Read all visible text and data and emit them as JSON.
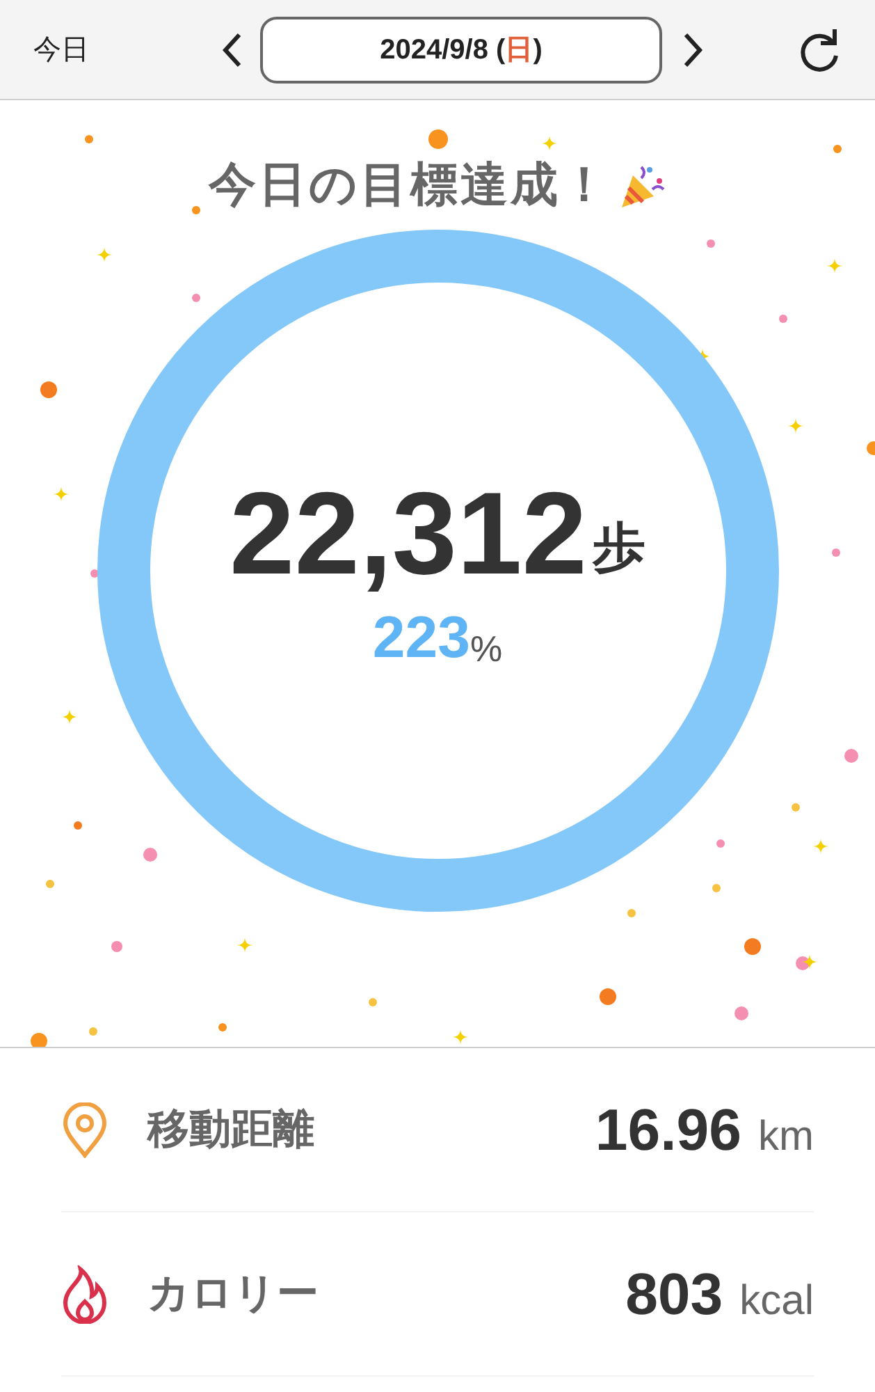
{
  "header": {
    "today_button": "今日",
    "date_prefix": "2024/9/8 (",
    "weekday": "日",
    "date_suffix": ")"
  },
  "goal": {
    "title": "今日の目標達成！",
    "steps": "22,312",
    "steps_unit": "歩",
    "percent": "223",
    "percent_unit": "%",
    "level": 1
  },
  "stats": [
    {
      "kind": "distance",
      "label": "移動距離",
      "value": "16.96",
      "unit": "km"
    },
    {
      "kind": "calories",
      "label": "カロリー",
      "value": "803",
      "unit": "kcal"
    }
  ]
}
